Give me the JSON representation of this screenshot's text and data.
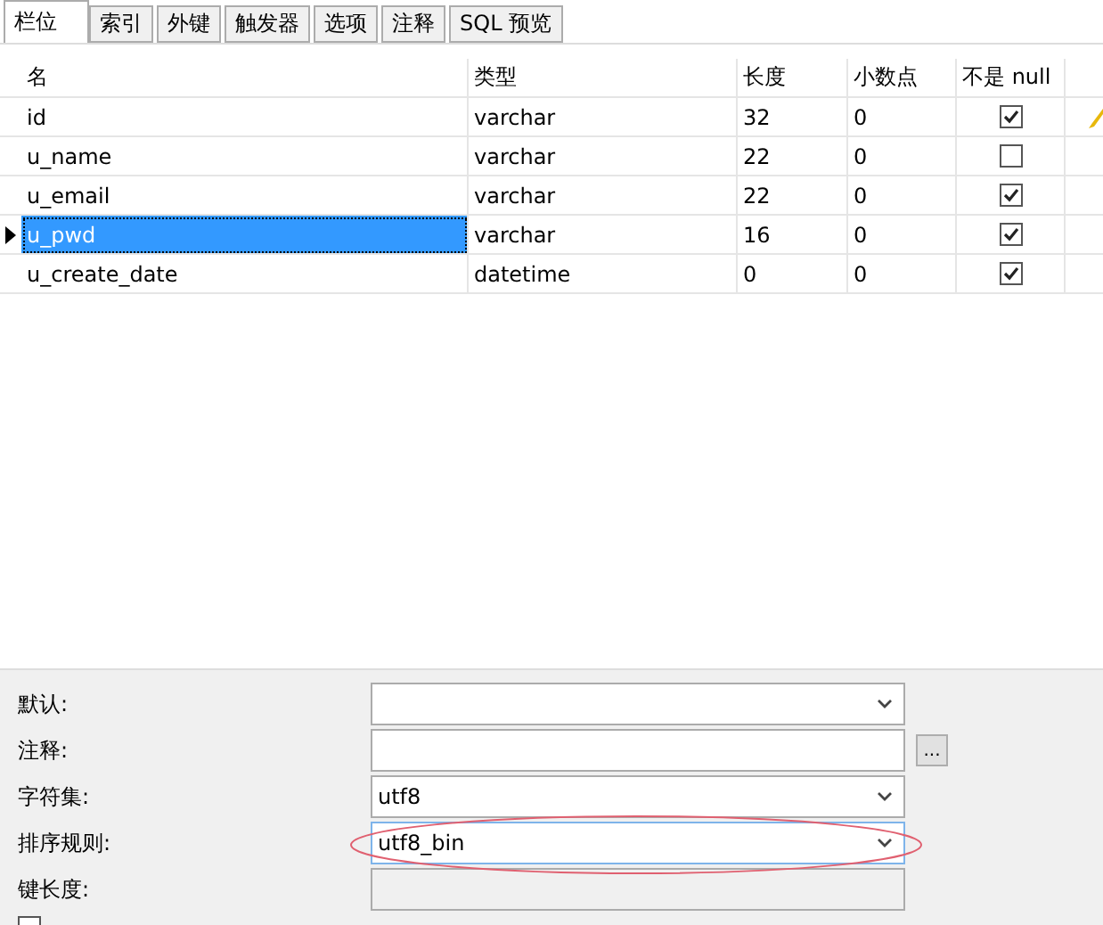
{
  "tabs": [
    {
      "label": "栏位",
      "selected": true
    },
    {
      "label": "索引",
      "selected": false
    },
    {
      "label": "外键",
      "selected": false
    },
    {
      "label": "触发器",
      "selected": false
    },
    {
      "label": "选项",
      "selected": false
    },
    {
      "label": "注释",
      "selected": false
    },
    {
      "label": "SQL 预览",
      "selected": false
    }
  ],
  "table": {
    "columns": [
      "名",
      "类型",
      "长度",
      "小数点",
      "不是 null"
    ],
    "rows": [
      {
        "name": "id",
        "type": "varchar",
        "length": "32",
        "decimals": "0",
        "not_null": true,
        "primary_key": true,
        "selected": false
      },
      {
        "name": "u_name",
        "type": "varchar",
        "length": "22",
        "decimals": "0",
        "not_null": false,
        "primary_key": false,
        "selected": false
      },
      {
        "name": "u_email",
        "type": "varchar",
        "length": "22",
        "decimals": "0",
        "not_null": true,
        "primary_key": false,
        "selected": false
      },
      {
        "name": "u_pwd",
        "type": "varchar",
        "length": "16",
        "decimals": "0",
        "not_null": true,
        "primary_key": false,
        "selected": true
      },
      {
        "name": "u_create_date",
        "type": "datetime",
        "length": "0",
        "decimals": "0",
        "not_null": true,
        "primary_key": false,
        "selected": false
      }
    ]
  },
  "properties": [
    {
      "label": "默认:",
      "kind": "dropdown",
      "highlighted": false
    },
    {
      "label": "注释:",
      "kind": "text",
      "button": "...",
      "highlighted": false
    },
    {
      "label": "字符集:",
      "kind": "dropdown",
      "value": "utf8",
      "highlighted": false
    },
    {
      "label": "排序规则:",
      "kind": "dropdown",
      "value": "utf8_bin",
      "highlighted": true
    },
    {
      "label": "键长度:",
      "kind": "readonly",
      "highlighted": false
    }
  ],
  "binary_checkbox": {
    "checked": false
  }
}
